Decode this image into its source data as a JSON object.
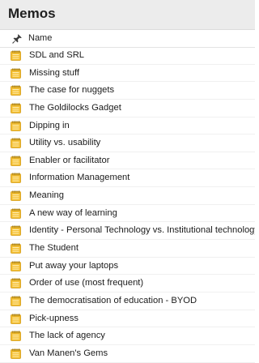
{
  "panel": {
    "title": "Memos",
    "column_header": "Name",
    "memo_icon_color": "#f5c033",
    "rows": [
      {
        "label": "SDL and SRL",
        "icon": "memo-icon"
      },
      {
        "label": "Missing stuff",
        "icon": "memo-icon"
      },
      {
        "label": "The case for nuggets",
        "icon": "memo-icon"
      },
      {
        "label": "The Goldilocks Gadget",
        "icon": "memo-icon"
      },
      {
        "label": "Dipping in",
        "icon": "memo-icon"
      },
      {
        "label": "Utility vs. usability",
        "icon": "memo-icon"
      },
      {
        "label": "Enabler or facilitator",
        "icon": "memo-icon"
      },
      {
        "label": "Information Management",
        "icon": "memo-icon"
      },
      {
        "label": "Meaning",
        "icon": "memo-icon"
      },
      {
        "label": "A new way of learning",
        "icon": "memo-icon"
      },
      {
        "label": "Identity - Personal Technology vs. Institutional technology",
        "icon": "memo-icon"
      },
      {
        "label": "The Student",
        "icon": "memo-icon"
      },
      {
        "label": "Put away your laptops",
        "icon": "memo-icon"
      },
      {
        "label": "Order of use (most frequent)",
        "icon": "memo-icon"
      },
      {
        "label": "The democratisation of education - BYOD",
        "icon": "memo-icon"
      },
      {
        "label": "Pick-upness",
        "icon": "memo-icon"
      },
      {
        "label": "The lack of agency",
        "icon": "memo-icon"
      },
      {
        "label": "Van Manen's Gems",
        "icon": "memo-icon"
      }
    ]
  }
}
